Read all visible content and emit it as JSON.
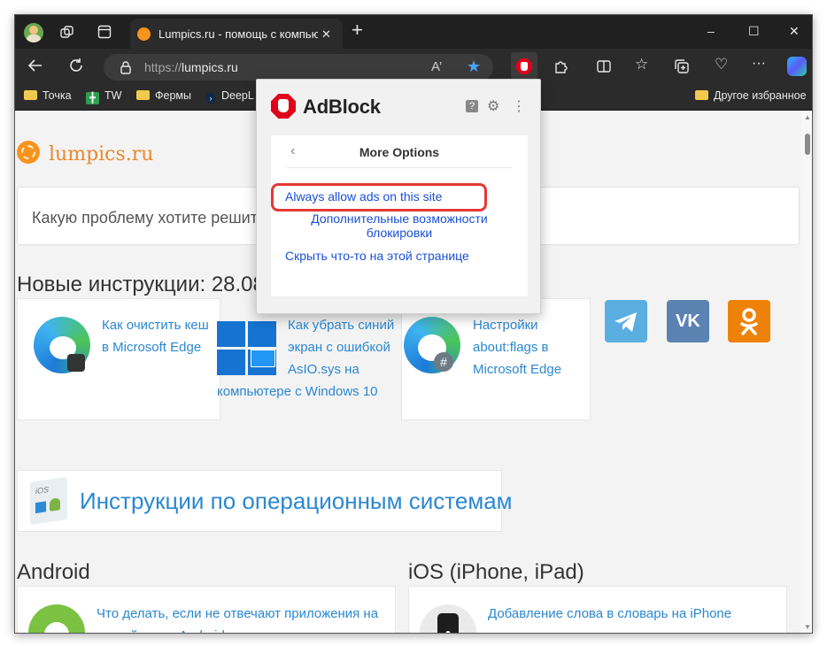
{
  "browser": {
    "tab_title": "Lumpics.ru - помощь с компьютером",
    "new_tab_glyph": "+",
    "url_scheme": "https://",
    "url_host": "lumpics.ru",
    "window_controls": {
      "minimize": "–",
      "maximize": "☐",
      "close": "✕"
    },
    "toolbar_icons": [
      "back-icon",
      "refresh-icon",
      "lock-icon",
      "read-aloud-icon",
      "favorite-star-icon",
      "adblock-icon",
      "extensions-icon",
      "split-screen-icon",
      "favorites-icon",
      "collections-icon",
      "performance-icon",
      "more-icon",
      "copilot-icon"
    ],
    "read_aloud": "A’",
    "more": "···",
    "bookmarks": [
      {
        "label": "Точка",
        "icon": "folder-icon"
      },
      {
        "label": "TW",
        "icon": "tw-icon"
      },
      {
        "label": "Фермы",
        "icon": "folder-icon"
      },
      {
        "label": "DeepL",
        "icon": "deepl-icon"
      }
    ],
    "other_favorites": "Другое избранное",
    "accent": "#f7941d"
  },
  "page": {
    "site_name": "lumpics.ru",
    "search_placeholder": "Какую проблему хотите решить?",
    "new_heading": "Новые инструкции: 28.08",
    "cards": [
      {
        "lines": [
          "Как очистить кеш",
          "в Microsoft Edge"
        ],
        "image": "edge-icon"
      },
      {
        "lines": [
          "Как убрать синий",
          "экран с ошибкой",
          "AsIO.sys на",
          "компьютере с Windows 10"
        ],
        "image": "windows-icon"
      },
      {
        "lines": [
          "Настройки",
          "about:flags в",
          "Microsoft Edge"
        ],
        "image": "edge-flags-icon"
      }
    ],
    "social": [
      {
        "name": "telegram",
        "color": "#5aaee0",
        "glyph": "➤"
      },
      {
        "name": "vk",
        "color": "#5b83b2",
        "glyph": "VK"
      },
      {
        "name": "odnoklassniki",
        "color": "#ee8208",
        "glyph": "ОК"
      }
    ],
    "os_heading": "Инструкции по операционным системам",
    "android_heading": "Android",
    "ios_heading": "iOS (iPhone, iPad)",
    "android_article": [
      "Что делать, если не отвечают приложения на",
      "устройстве с Android"
    ],
    "ios_article": "Добавление слова в словарь на iPhone"
  },
  "popup": {
    "brand": "AdBlock",
    "brand_color": "#e0001b",
    "help_glyph": "?",
    "settings_glyph": "⚙",
    "menu_glyph": "⋮",
    "back_glyph": "‹",
    "panel_title": "More Options",
    "options": [
      "Always allow ads on this site",
      "Дополнительные возможности",
      "блокировки",
      "Скрыть что-то на этой странице"
    ],
    "highlight_color": "#e53935"
  }
}
